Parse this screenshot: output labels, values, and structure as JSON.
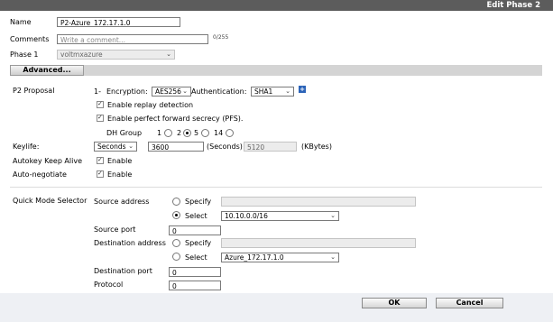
{
  "window": {
    "title": "Edit Phase 2"
  },
  "form": {
    "name_label": "Name",
    "name_value": "P2-Azure_172.17.1.0",
    "comments_label": "Comments",
    "comments_placeholder": "Write a comment...",
    "comments_counter": "0/255",
    "phase1_label": "Phase 1",
    "phase1_value": "voltmxazure",
    "advanced_label": "Advanced..."
  },
  "proposal": {
    "label": "P2 Proposal",
    "index": "1-",
    "encryption_label": "Encryption:",
    "encryption_value": "AES256",
    "authentication_label": "Authentication:",
    "authentication_value": "SHA1",
    "replay_label": "Enable replay detection",
    "pfs_label": "Enable perfect forward secrecy (PFS).",
    "dh_label": "DH Group",
    "dh_options": [
      "1",
      "2",
      "5",
      "14"
    ],
    "dh_selected": "5"
  },
  "keylife": {
    "label": "Keylife:",
    "unit_value": "Seconds",
    "seconds_value": "3600",
    "seconds_label": "(Seconds)",
    "kbytes_value": "5120",
    "kbytes_label": "(KBytes)"
  },
  "autokey": {
    "label": "Autokey Keep Alive",
    "option": "Enable"
  },
  "autonegotiate": {
    "label": "Auto-negotiate",
    "option": "Enable"
  },
  "selector": {
    "label": "Quick Mode Selector",
    "source_address_label": "Source address",
    "specify_label": "Specify",
    "select_label": "Select",
    "source_address_value": "10.10.0.0/16",
    "source_port_label": "Source port",
    "source_port_value": "0",
    "destination_address_label": "Destination address",
    "destination_address_value": "Azure_172.17.1.0",
    "destination_port_label": "Destination port",
    "destination_port_value": "0",
    "protocol_label": "Protocol",
    "protocol_value": "0"
  },
  "footer": {
    "ok_label": "OK",
    "cancel_label": "Cancel"
  }
}
